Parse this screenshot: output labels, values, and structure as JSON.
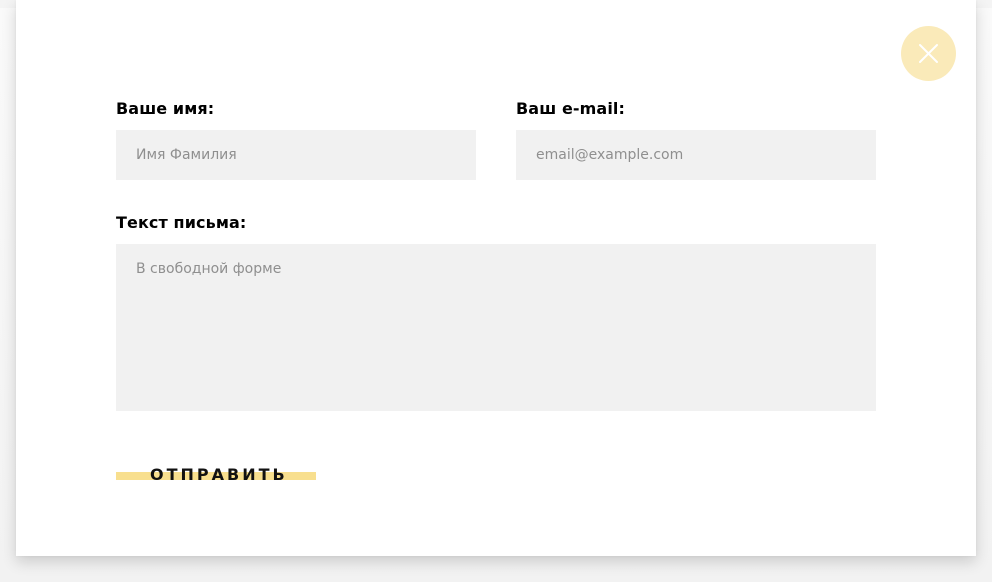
{
  "form": {
    "name_label": "Ваше имя:",
    "name_placeholder": "Имя Фамилия",
    "email_label": "Ваш e-mail:",
    "email_placeholder": "email@example.com",
    "message_label": "Текст письма:",
    "message_placeholder": "В свободной форме",
    "submit_label": "ОТПРАВИТЬ"
  },
  "close_button": {
    "icon": "close-icon",
    "color": "#faeab9"
  },
  "colors": {
    "accent": "#f8df8e",
    "field_background": "#f1f1f1",
    "text": "#000000"
  }
}
